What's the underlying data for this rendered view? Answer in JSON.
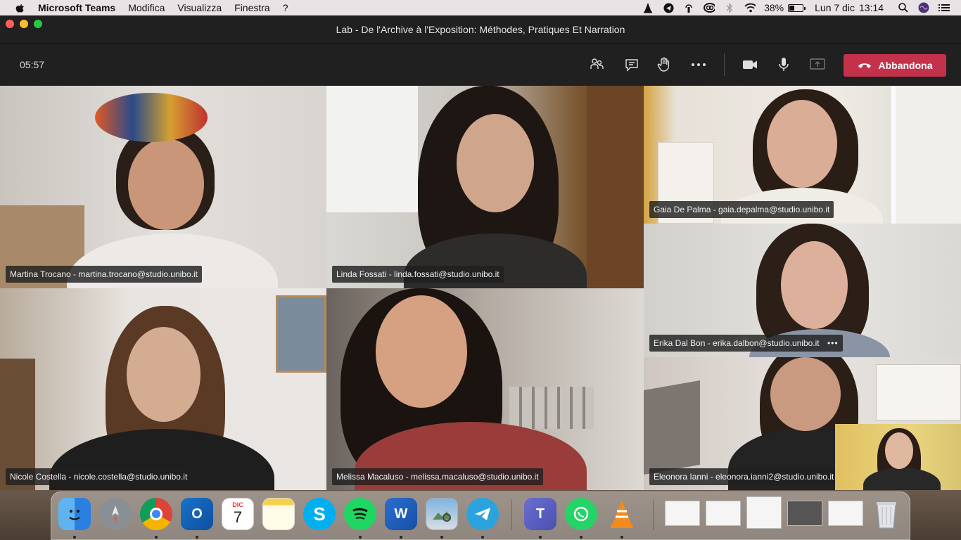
{
  "menubar": {
    "app_name": "Microsoft Teams",
    "menus": [
      "Modifica",
      "Visualizza",
      "Finestra",
      "?"
    ],
    "battery_percent": "38%",
    "date": "Lun 7 dic",
    "time": "13:14"
  },
  "window": {
    "title": "Lab - De l'Archive à l'Exposition: Méthodes, Pratiques Et Narration"
  },
  "meeting": {
    "timer": "05:57",
    "toolbar_icons": [
      "participants-icon",
      "chat-icon",
      "raise-hand-icon",
      "more-icon",
      "camera-icon",
      "microphone-icon",
      "share-screen-icon"
    ],
    "leave_label": "Abbandona",
    "leave_color": "#c4314b"
  },
  "participants": [
    {
      "label": "Martina Trocano - martina.trocano@studio.unibo.it"
    },
    {
      "label": "Linda Fossati - linda.fossati@studio.unibo.it"
    },
    {
      "label": "Gaia De Palma - gaia.depalma@studio.unibo.it"
    },
    {
      "label": "Erika Dal Bon - erika.dalbon@studio.unibo.it",
      "more": "•••"
    },
    {
      "label": "Nicole Costella - nicole.costella@studio.unibo.it"
    },
    {
      "label": "Melissa Macaluso - melissa.macaluso@studio.unibo.it"
    },
    {
      "label": "Eleonora Ianni - eleonora.ianni2@studio.unibo.it"
    }
  ],
  "dock": {
    "calendar_month": "DIC",
    "calendar_day": "7",
    "apps": [
      "finder-icon",
      "launchpad-icon",
      "chrome-icon",
      "outlook-icon",
      "calendar-icon",
      "notes-icon",
      "skype-icon",
      "spotify-icon",
      "word-icon",
      "preview-icon",
      "telegram-icon",
      "teams-icon",
      "whatsapp-icon",
      "vlc-icon"
    ]
  }
}
